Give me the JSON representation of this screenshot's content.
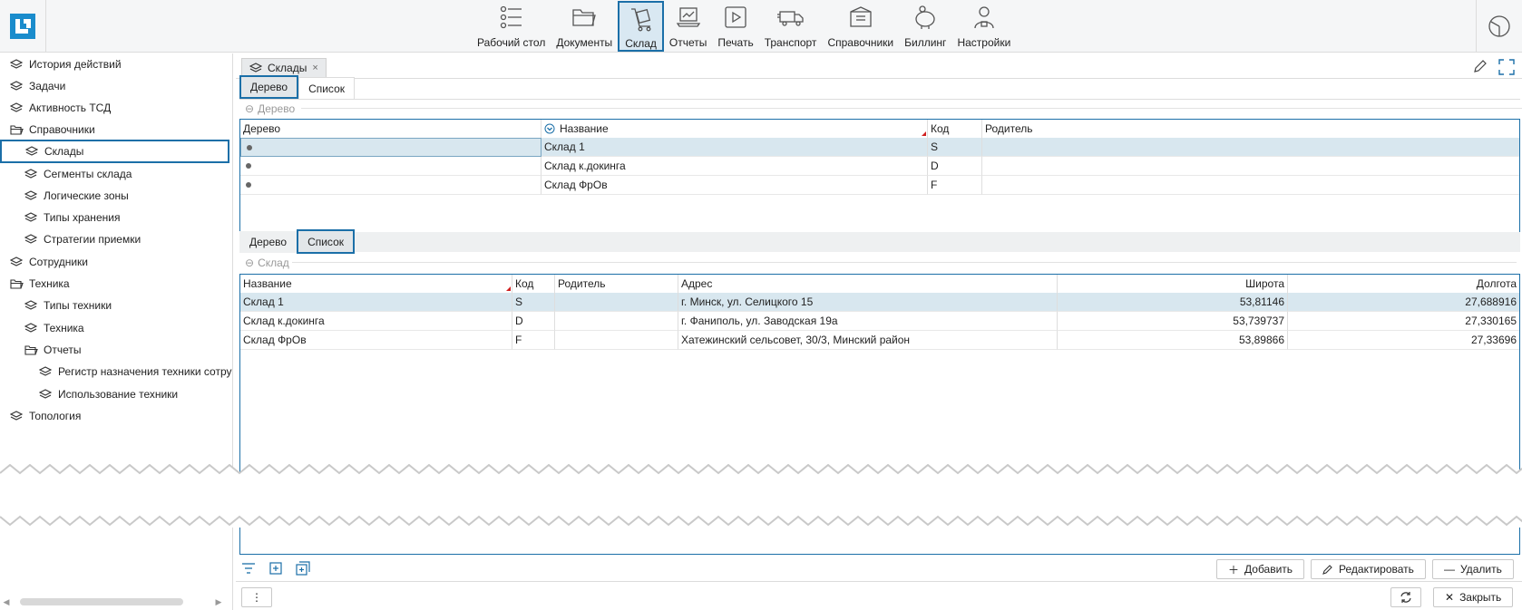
{
  "nav": {
    "items": [
      {
        "label": "Рабочий стол",
        "icon": "dashboard-list-icon"
      },
      {
        "label": "Документы",
        "icon": "folder-icon"
      },
      {
        "label": "Склад",
        "icon": "warehouse-cart-icon",
        "active": true
      },
      {
        "label": "Отчеты",
        "icon": "report-laptop-icon"
      },
      {
        "label": "Печать",
        "icon": "print-play-icon"
      },
      {
        "label": "Транспорт",
        "icon": "truck-icon"
      },
      {
        "label": "Справочники",
        "icon": "box-icon"
      },
      {
        "label": "Биллинг",
        "icon": "piggy-bank-icon"
      },
      {
        "label": "Настройки",
        "icon": "user-settings-icon"
      }
    ]
  },
  "sidebar": {
    "items": [
      {
        "label": "История действий",
        "icon": "layers-icon"
      },
      {
        "label": "Задачи",
        "icon": "layers-icon"
      },
      {
        "label": "Активность ТСД",
        "icon": "layers-icon"
      },
      {
        "label": "Справочники",
        "icon": "folder-open-icon"
      },
      {
        "label": "Склады",
        "icon": "layers-icon",
        "selected": true
      },
      {
        "label": "Сегменты склада",
        "icon": "layers-icon"
      },
      {
        "label": "Логические зоны",
        "icon": "layers-icon"
      },
      {
        "label": "Типы хранения",
        "icon": "layers-icon"
      },
      {
        "label": "Стратегии приемки",
        "icon": "layers-icon"
      },
      {
        "label": "Сотрудники",
        "icon": "layers-icon"
      },
      {
        "label": "Техника",
        "icon": "folder-open-icon"
      },
      {
        "label": "Типы техники",
        "icon": "layers-icon"
      },
      {
        "label": "Техника",
        "icon": "layers-icon"
      },
      {
        "label": "Отчеты",
        "icon": "folder-open-icon"
      },
      {
        "label": "Регистр назначения техники сотру",
        "icon": "layers-icon"
      },
      {
        "label": "Использование техники",
        "icon": "layers-icon"
      },
      {
        "label": "Топология",
        "icon": "layers-icon"
      }
    ]
  },
  "doc_tab": {
    "label": "Склады",
    "close": "×"
  },
  "top_tabs": {
    "tree": "Дерево",
    "list": "Список"
  },
  "tree_group": {
    "label": "Дерево"
  },
  "tree_grid": {
    "columns": [
      "Дерево",
      "Название",
      "Код",
      "Родитель"
    ],
    "rows": [
      {
        "name": "Склад 1",
        "code": "S",
        "parent": ""
      },
      {
        "name": "Склад к.докинга",
        "code": "D",
        "parent": ""
      },
      {
        "name": "Склад ФрОв",
        "code": "F",
        "parent": ""
      }
    ]
  },
  "bottom_tabs": {
    "tree": "Дерево",
    "list": "Список"
  },
  "list_group": {
    "label": "Склад"
  },
  "list_grid": {
    "columns": [
      "Название",
      "Код",
      "Родитель",
      "Адрес",
      "Широта",
      "Долгота"
    ],
    "rows": [
      {
        "name": "Склад 1",
        "code": "S",
        "parent": "",
        "address": "г. Минск, ул. Селицкого 15",
        "lat": "53,81146",
        "lon": "27,688916"
      },
      {
        "name": "Склад к.докинга",
        "code": "D",
        "parent": "",
        "address": "г. Фаниполь, ул. Заводская 19а",
        "lat": "53,739737",
        "lon": "27,330165"
      },
      {
        "name": "Склад ФрОв",
        "code": "F",
        "parent": "",
        "address": "Хатежинский сельсовет, 30/3, Минский район",
        "lat": "53,89866",
        "lon": "27,33696"
      }
    ]
  },
  "actions": {
    "add": "Добавить",
    "edit": "Редактировать",
    "delete": "Удалить",
    "close": "Закрыть",
    "more": "⋮"
  },
  "colors": {
    "accent": "#1b6fa8",
    "selected_row": "#d8e7ef",
    "logo": "#1a8ccc"
  }
}
